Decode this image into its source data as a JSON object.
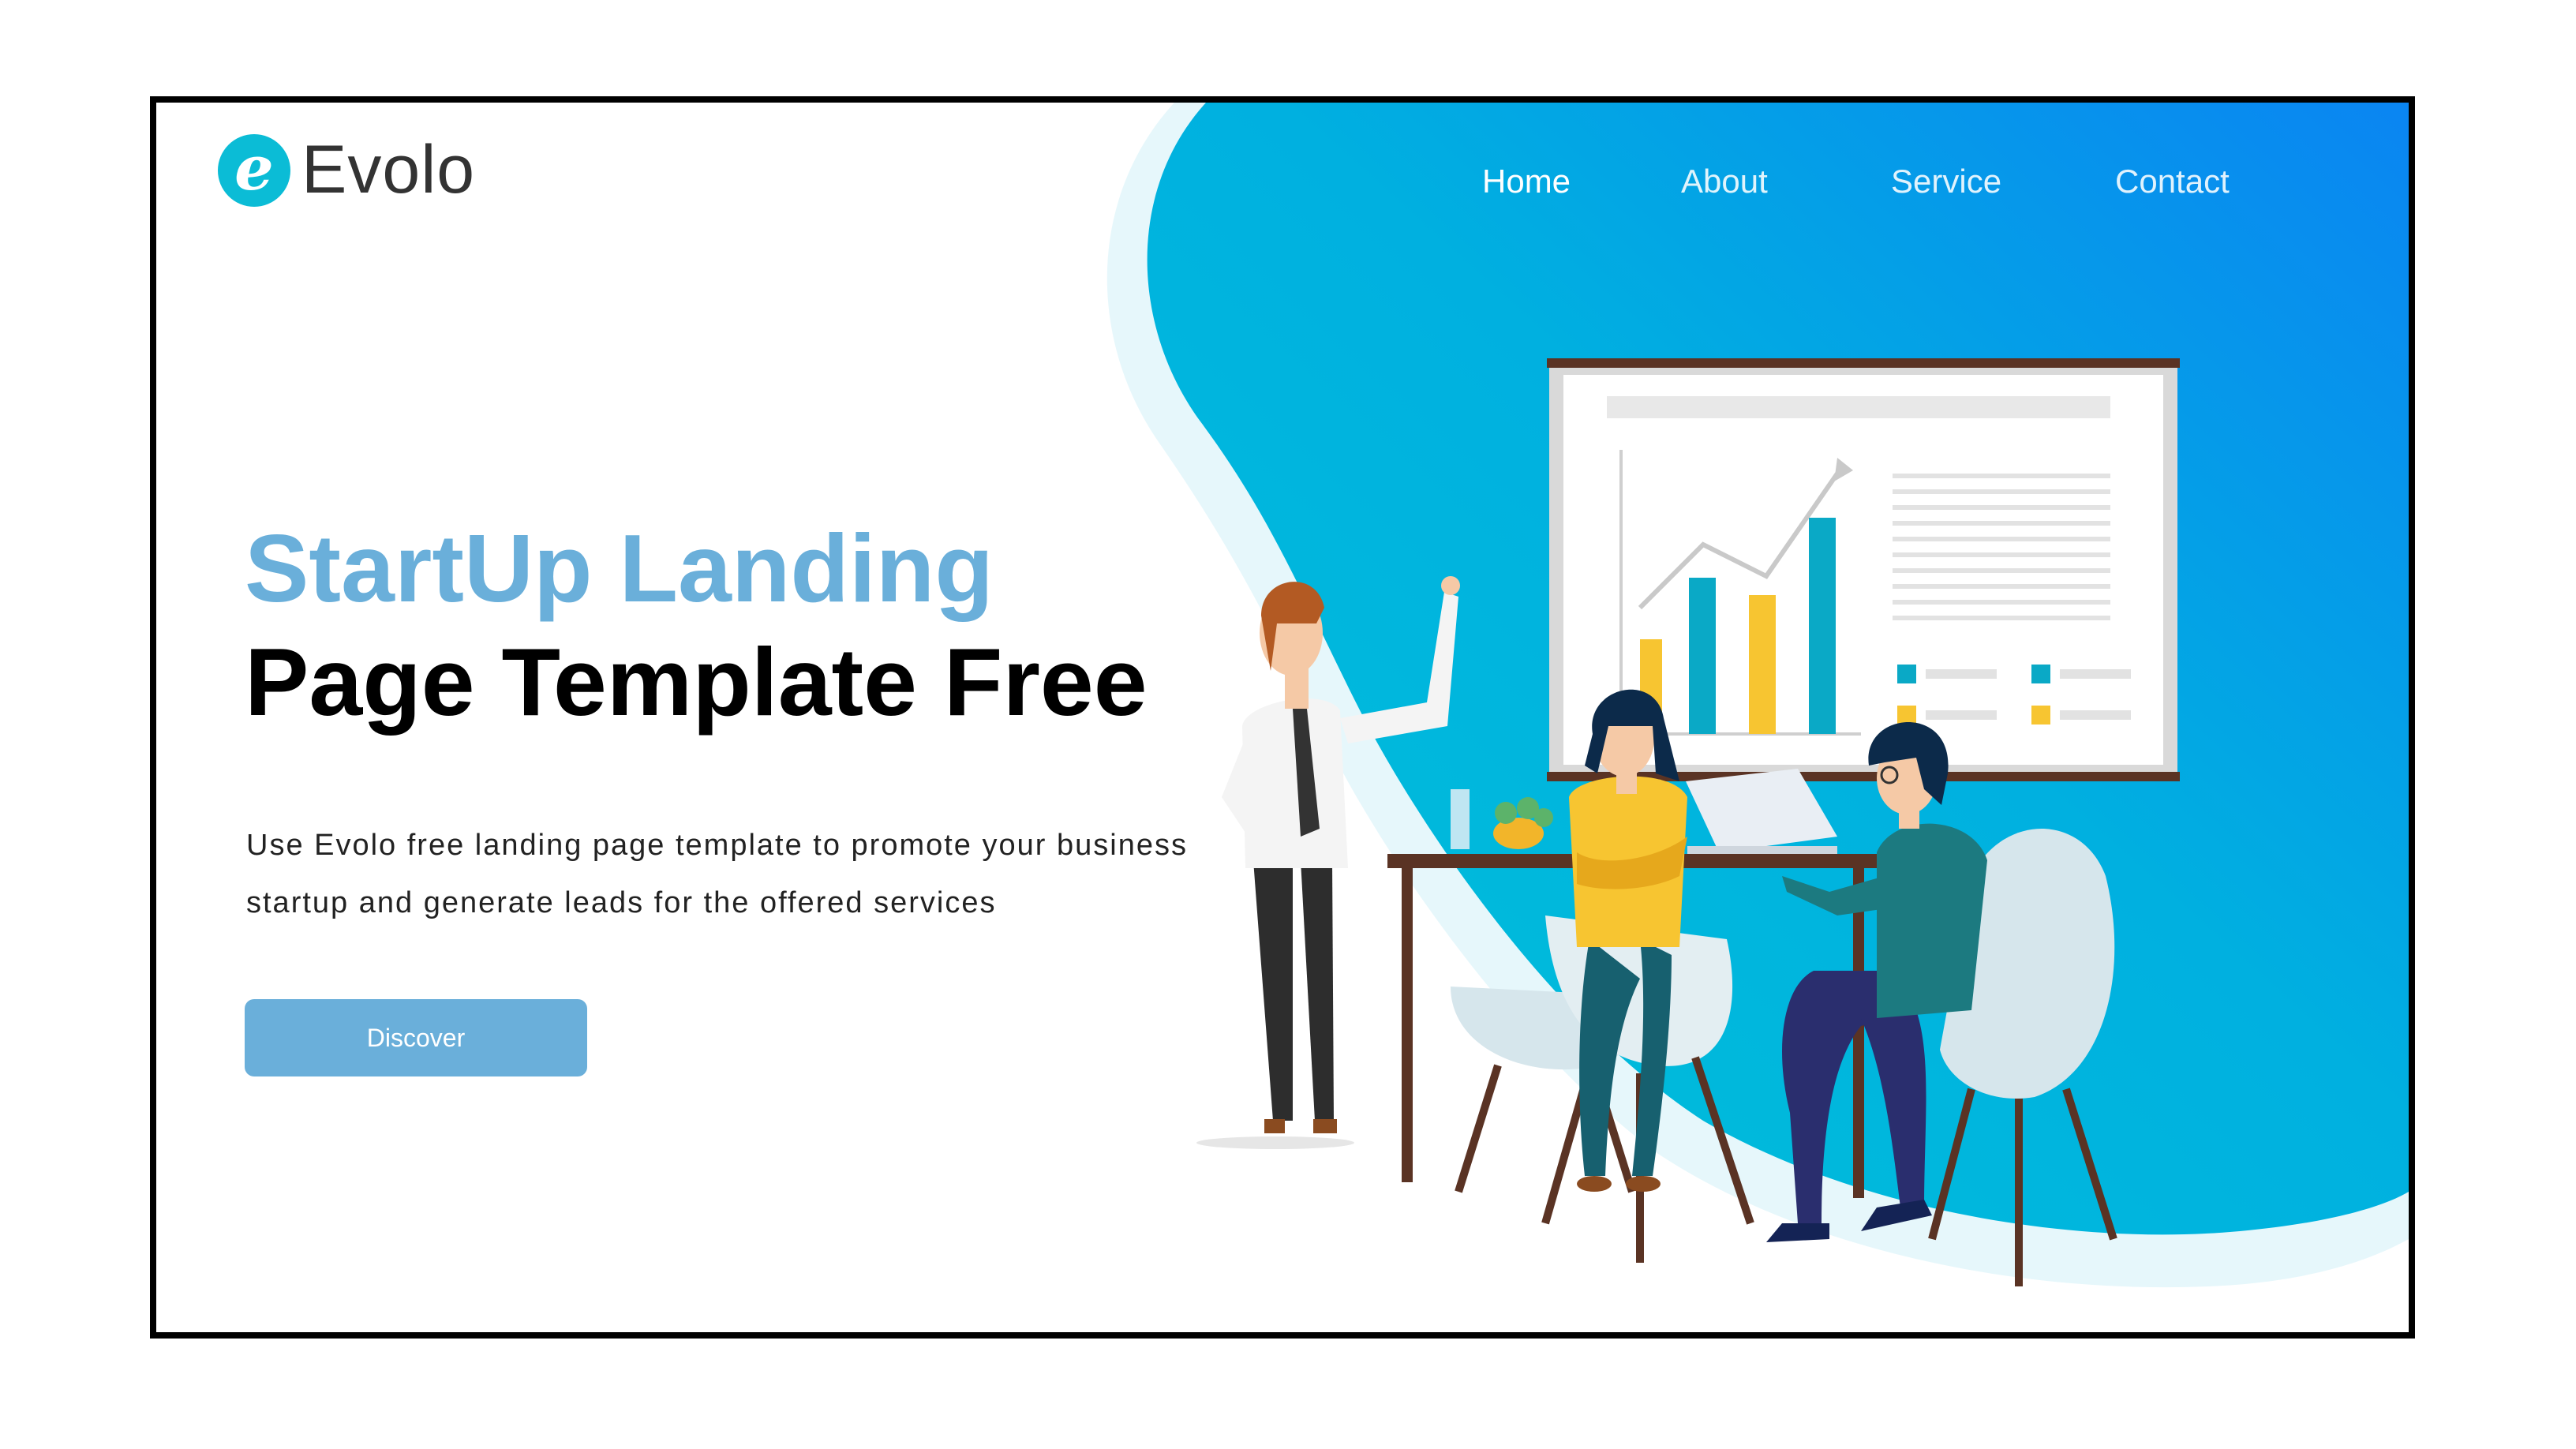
{
  "brand": {
    "logo_letter": "e",
    "name": "Evolo",
    "colors": {
      "accent": "#6aafda",
      "logo": "#0bbcd6",
      "gradient_start": "#00c2d8",
      "gradient_end": "#0a85f2"
    }
  },
  "nav": {
    "items": [
      {
        "label": "Home",
        "active": true
      },
      {
        "label": "About",
        "active": false
      },
      {
        "label": "Service",
        "active": false
      },
      {
        "label": "Contact",
        "active": false
      }
    ]
  },
  "hero": {
    "title_line1": "StartUp Landing",
    "title_line2": "Page Template Free",
    "description": "Use Evolo free landing page template to promote your business startup and generate leads for the offered services",
    "button_label": "Discover"
  },
  "illustration": {
    "subject": "team-meeting-with-presentation-board"
  }
}
